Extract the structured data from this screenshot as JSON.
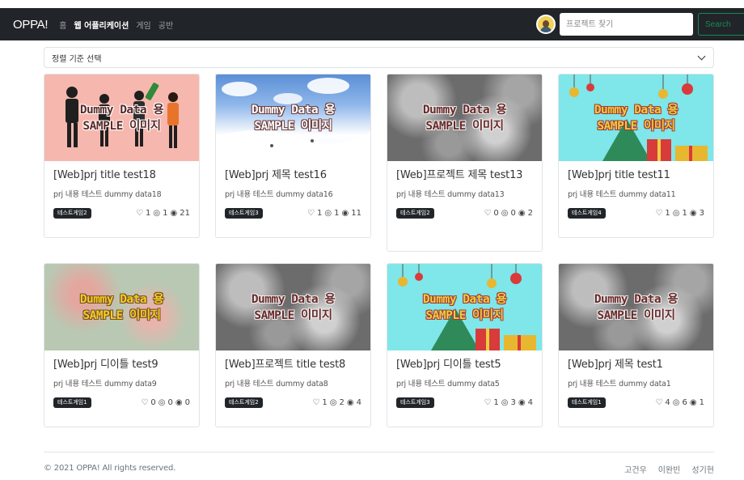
{
  "navbar": {
    "brand": "OPPA!",
    "links": [
      "홈",
      "웹 어플리케이션",
      "게임",
      "공반"
    ],
    "search_placeholder": "프로젝트 찾기",
    "search_button": "Search"
  },
  "sort": {
    "selected": "정렬 기준 선택"
  },
  "image_caption": {
    "line1": "Dummy Data 용",
    "line2": "SAMPLE 이미지"
  },
  "cards": [
    {
      "title": "[Web]prj title test18",
      "desc": "prj 내용 테스트 dummy data18",
      "badge": "테스트게임2",
      "likes": "1",
      "comments": "1",
      "views": "21"
    },
    {
      "title": "[Web]prj 제목 test16",
      "desc": "prj 내용 테스트 dummy data16",
      "badge": "테스트게임3",
      "likes": "1",
      "comments": "1",
      "views": "11"
    },
    {
      "title": "[Web]프로젝트 제목 test13",
      "desc": "prj 내용 테스트 dummy data13",
      "badge": "테스트게임2",
      "likes": "0",
      "comments": "0",
      "views": "2"
    },
    {
      "title": "[Web]prj title test11",
      "desc": "prj 내용 테스트 dummy data11",
      "badge": "테스트게임4",
      "likes": "1",
      "comments": "1",
      "views": "3"
    },
    {
      "title": "[Web]prj 디이틀 test9",
      "desc": "prj 내용 테스트 dummy data9",
      "badge": "테스트게임1",
      "likes": "0",
      "comments": "0",
      "views": "0"
    },
    {
      "title": "[Web]프로젝트 title test8",
      "desc": "prj 내용 테스트 dummy data8",
      "badge": "테스트게임2",
      "likes": "1",
      "comments": "2",
      "views": "4"
    },
    {
      "title": "[Web]prj 디이틀 test5",
      "desc": "prj 내용 테스트 dummy data5",
      "badge": "테스트게임3",
      "likes": "1",
      "comments": "3",
      "views": "4"
    },
    {
      "title": "[Web]prj 제목 test1",
      "desc": "prj 내용 테스트 dummy data1",
      "badge": "테스트게임1",
      "likes": "4",
      "comments": "6",
      "views": "1"
    }
  ],
  "footer": {
    "copyright": "© 2021 OPPA! All rights reserved.",
    "names": [
      "고건우",
      "이완빈",
      "성기현"
    ]
  }
}
